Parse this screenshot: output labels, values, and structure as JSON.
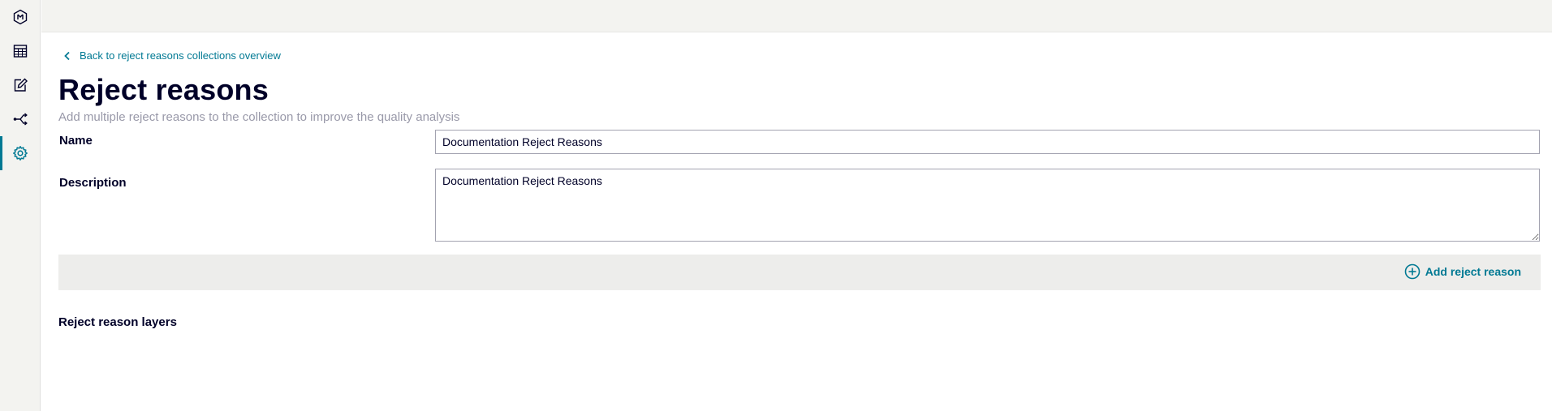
{
  "sidebar": {
    "items": [
      {
        "icon": "app-logo-icon",
        "active": false
      },
      {
        "icon": "calendar-grid-icon",
        "active": false
      },
      {
        "icon": "edit-document-icon",
        "active": false
      },
      {
        "icon": "workflow-branch-icon",
        "active": false
      },
      {
        "icon": "gear-icon",
        "active": true
      }
    ]
  },
  "colors": {
    "accent": "#007993",
    "title": "#000028",
    "subtitle": "#9999a9",
    "sidebar_bg": "#f3f3f0",
    "action_bar_bg": "#ededeb"
  },
  "breadcrumb": {
    "back_label": "Back to reject reasons collections overview"
  },
  "page": {
    "title": "Reject reasons",
    "subtitle": "Add multiple reject reasons to the collection to improve the quality analysis"
  },
  "form": {
    "name_label": "Name",
    "name_value": "Documentation Reject Reasons",
    "description_label": "Description",
    "description_value": "Documentation Reject Reasons"
  },
  "actions": {
    "add_reject_reason": "Add reject reason"
  },
  "sections": {
    "layers_heading": "Reject reason layers"
  }
}
